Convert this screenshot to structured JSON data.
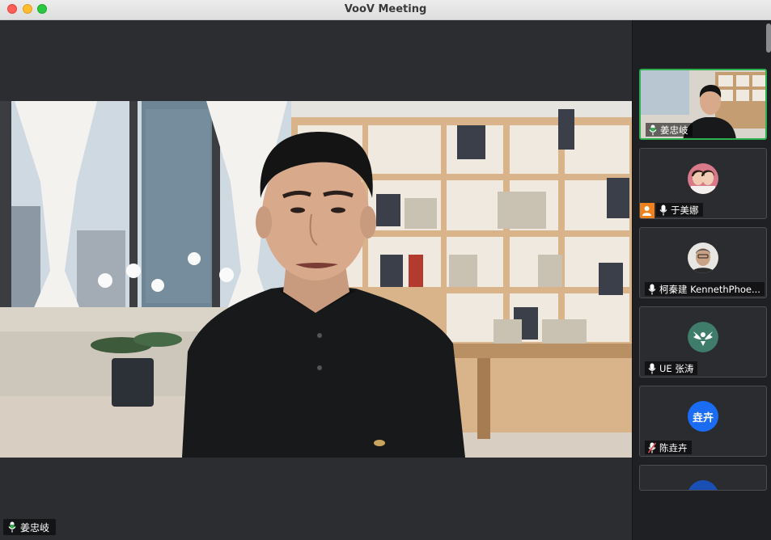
{
  "window": {
    "title": "VooV Meeting"
  },
  "main_speaker": {
    "name": "姜忠岐",
    "mic": "active"
  },
  "participants": [
    {
      "name": "姜忠岐",
      "mic": "active",
      "video": true,
      "speaking": true
    },
    {
      "name": "于美娜",
      "mic": "on",
      "avatar": "photo",
      "host": true
    },
    {
      "name": "柯秦建 KennethPhoe...",
      "mic": "on",
      "avatar": "photo"
    },
    {
      "name": "UE 张涛",
      "mic": "on",
      "avatar": "logo"
    },
    {
      "name": "陈垚卉",
      "mic": "muted",
      "avatar_text": "垚卉",
      "avatar_color": "#1a6cf5"
    }
  ],
  "colors": {
    "active_border": "#2eb24f",
    "host_badge": "#f0821e",
    "avatar_blue": "#1a6cf5",
    "sidebar_bg": "#1f2023",
    "stage_bg": "#2b2d31"
  }
}
